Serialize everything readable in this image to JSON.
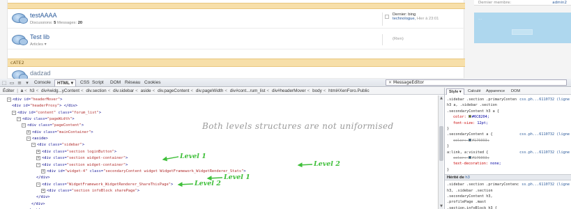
{
  "forum": {
    "category_2": "cATE2",
    "nodes": [
      {
        "title": "testAAAA",
        "meta_label": "Discussions:",
        "discussions": "5",
        "meta_label_2": "Messages:",
        "messages": "20",
        "last_label": "Dernier: bing",
        "last_link": "technologue,",
        "last_date": "Hier à 23:01"
      },
      {
        "title": "Test lib",
        "sub": "Articles ▾",
        "last_none": "(Rien)"
      },
      {
        "title": "dadzad"
      }
    ],
    "sidebar": {
      "member_label": "Dernier membre:",
      "member_name": "admin2",
      "highlight_text": "…"
    }
  },
  "devtools": {
    "toolbar": {
      "icons": [
        "inspect-icon",
        "console-view-icon",
        "menu-icon"
      ],
      "tabs": [
        "Console",
        "HTML ▾",
        "CSS",
        "Script",
        "DOM",
        "Réseau",
        "Cookies"
      ],
      "active_tab": 1,
      "search_value": "MessageEditor"
    },
    "breadcrumb": {
      "edit_label": "Éditer",
      "items": [
        "a",
        "h3",
        "div#widg...yContent",
        "div.section",
        "div.sidebar",
        "aside",
        "div.pageContent",
        "div.pageWidth",
        "div#cont...rum_list",
        "div#headerMover",
        "body",
        "html#XenForo.Public"
      ]
    },
    "tree": [
      {
        "indent": 0,
        "tog": "⊟",
        "tag": "<div",
        "attrs": [
          [
            "id",
            "headerMover"
          ]
        ],
        "end": ">"
      },
      {
        "indent": 1,
        "tog": "",
        "tag": "<div",
        "attrs": [
          [
            "id",
            "headerProxy"
          ]
        ],
        "end": "> </div>"
      },
      {
        "indent": 1,
        "tog": "⊟",
        "tag": "<div",
        "attrs": [
          [
            "id",
            "content"
          ],
          [
            "class",
            "forum_list"
          ]
        ],
        "end": ">"
      },
      {
        "indent": 2,
        "tog": "⊟",
        "tag": "<div",
        "attrs": [
          [
            "class",
            "pageWidth"
          ]
        ],
        "end": ">"
      },
      {
        "indent": 3,
        "tog": "⊟",
        "tag": "<div",
        "attrs": [
          [
            "class",
            "pageContent"
          ]
        ],
        "end": ">"
      },
      {
        "indent": 4,
        "tog": "⊞",
        "tag": "<div",
        "attrs": [
          [
            "class",
            "mainContainer"
          ]
        ],
        "end": ">"
      },
      {
        "indent": 4,
        "tog": "⊟",
        "tag": "<aside>",
        "attrs": [],
        "end": ""
      },
      {
        "indent": 5,
        "tog": "⊟",
        "tag": "<div",
        "attrs": [
          [
            "class",
            "sidebar"
          ]
        ],
        "end": ">"
      },
      {
        "indent": 6,
        "tog": "⊞",
        "tag": "<div",
        "attrs": [
          [
            "class",
            "section loginButton"
          ]
        ],
        "end": ">"
      },
      {
        "indent": 6,
        "tog": "⊞",
        "tag": "<div",
        "attrs": [
          [
            "class",
            "section widget-container"
          ]
        ],
        "end": ">"
      },
      {
        "indent": 6,
        "tog": "⊟",
        "tag": "<div",
        "attrs": [
          [
            "class",
            "section widget-container"
          ]
        ],
        "end": ">"
      },
      {
        "indent": 7,
        "tog": "⊞",
        "tag": "<div",
        "attrs": [
          [
            "id",
            "widget-4"
          ],
          [
            "class",
            "secondaryContent widget WidgetFramework_WidgetRenderer_Stats"
          ]
        ],
        "end": ">"
      },
      {
        "indent": 6,
        "tog": "",
        "tag": "</div>",
        "attrs": [],
        "end": ""
      },
      {
        "indent": 6,
        "tog": "⊟",
        "tag": "<div",
        "attrs": [
          [
            "class",
            "WidgetFramework_WidgetRenderer_ShareThisPage"
          ]
        ],
        "end": ">"
      },
      {
        "indent": 7,
        "tog": "⊞",
        "tag": "<div",
        "attrs": [
          [
            "class",
            "section infoBlock sharePage"
          ]
        ],
        "end": ">"
      },
      {
        "indent": 6,
        "tog": "",
        "tag": "</div>",
        "attrs": [],
        "end": ""
      },
      {
        "indent": 5,
        "tog": "",
        "tag": "</div>",
        "attrs": [],
        "end": ""
      },
      {
        "indent": 4,
        "tog": "",
        "tag": "</aside>",
        "attrs": [],
        "end": ""
      }
    ],
    "annotations": {
      "title": "Both levels structures are not uniformised",
      "level1a": "Level 1",
      "level2a": "Level 2",
      "level1b": "Level 1",
      "level2b": "Level 2"
    },
    "style_panel": {
      "tabs": [
        "Style ▾",
        "Calculé",
        "Apparence",
        "DOM"
      ],
      "active_tab": 0,
      "rules": [
        {
          "sel": ".sidebar .section .primaryConten",
          "src": "css.ph...6110732 (ligne"
        },
        {
          "sel": "h3 a, .sidebar .section"
        },
        {
          "sel": ".secondaryContent h3 a {"
        },
        {
          "prop": "color:",
          "val": "#6C8204;",
          "swatch": "#6C8204"
        },
        {
          "prop": "font-size:",
          "val": "12pt;"
        },
        {
          "sel": "}"
        },
        {
          "sel": ".secondaryContent a {",
          "src": "css.ph...6110732 (ligne"
        },
        {
          "prop": "color:",
          "val": "#176093;",
          "strike": true,
          "swatch": "#176093"
        },
        {
          "sel": "}"
        },
        {
          "sel": "a:link, a:visited {",
          "src": "css.ph...6110732 (ligne"
        },
        {
          "prop": "color:",
          "val": "#176093;",
          "strike": true,
          "swatch": "#176093"
        },
        {
          "prop": "text-decoration:",
          "val": "none;"
        },
        {
          "sel": "}"
        }
      ],
      "inherited_label": "Hérité de",
      "inherited_tag": "h3",
      "inherited_rules": [
        {
          "sel": ".sidebar .section .primaryContenc",
          "src": "ss.ph...6110732 (ligne"
        },
        {
          "sel": "h3, .sidebar .section"
        },
        {
          "sel": ".secondaryContent h3,"
        },
        {
          "sel": ".profilePage .mast"
        },
        {
          "sel": ".section.infoBlock h3 {"
        }
      ]
    }
  }
}
